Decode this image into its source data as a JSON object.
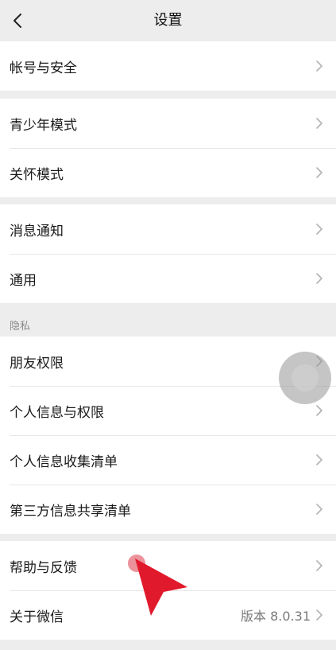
{
  "header": {
    "title": "设置"
  },
  "groups": {
    "account": [
      "帐号与安全"
    ],
    "youth": [
      "青少年模式",
      "关怀模式"
    ],
    "general": [
      "消息通知",
      "通用"
    ],
    "privacy_label": "隐私",
    "privacy": [
      "朋友权限",
      "个人信息与权限",
      "个人信息收集清单",
      "第三方信息共享清单"
    ],
    "help": [
      "帮助与反馈"
    ],
    "about": {
      "label": "关于微信",
      "value": "版本 8.0.31"
    }
  },
  "icons": {
    "back": "back-arrow-icon",
    "chevron": "chevron-right-icon"
  },
  "colors": {
    "background": "#ededed",
    "surface": "#ffffff",
    "text": "#1a1a1a",
    "secondary": "#7a7a7a",
    "pointer": "#e01a2c"
  }
}
